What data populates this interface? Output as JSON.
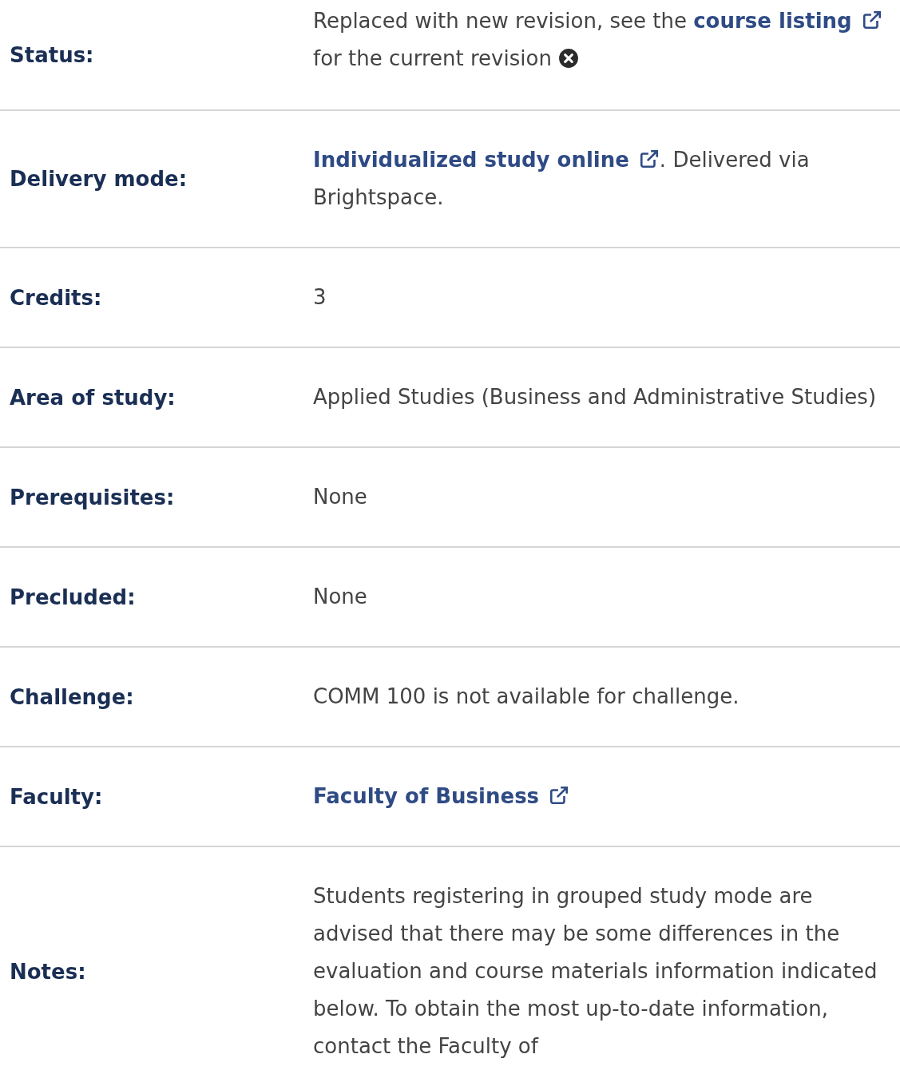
{
  "rows": [
    {
      "label": "Status:",
      "value": [
        {
          "kind": "text",
          "text": "Replaced with new revision, see the "
        },
        {
          "kind": "link",
          "text": "course listing"
        },
        {
          "kind": "text",
          "text": " for the current revision "
        },
        {
          "kind": "close_icon"
        }
      ]
    },
    {
      "label": "Delivery mode:",
      "value": [
        {
          "kind": "link",
          "text": "Individualized study online"
        },
        {
          "kind": "text",
          "text": ". Delivered via Brightspace."
        }
      ]
    },
    {
      "label": "Credits:",
      "value": [
        {
          "kind": "text",
          "text": "3"
        }
      ]
    },
    {
      "label": "Area of study:",
      "value": [
        {
          "kind": "text",
          "text": "Applied Studies (Business and Administrative Studies)"
        }
      ]
    },
    {
      "label": "Prerequisites:",
      "value": [
        {
          "kind": "text",
          "text": "None"
        }
      ]
    },
    {
      "label": "Precluded:",
      "value": [
        {
          "kind": "text",
          "text": "None"
        }
      ]
    },
    {
      "label": "Challenge:",
      "value": [
        {
          "kind": "text",
          "text": "COMM 100 is not available for challenge."
        }
      ]
    },
    {
      "label": "Faculty:",
      "value": [
        {
          "kind": "link",
          "text": "Faculty of Business"
        }
      ]
    },
    {
      "label": "Notes:",
      "value": [
        {
          "kind": "text",
          "text": "Students registering in grouped study mode are advised that there may be some differences in the evaluation and course materials information indicated below. To obtain the most up-to-date information, contact the Faculty of"
        }
      ]
    }
  ]
}
